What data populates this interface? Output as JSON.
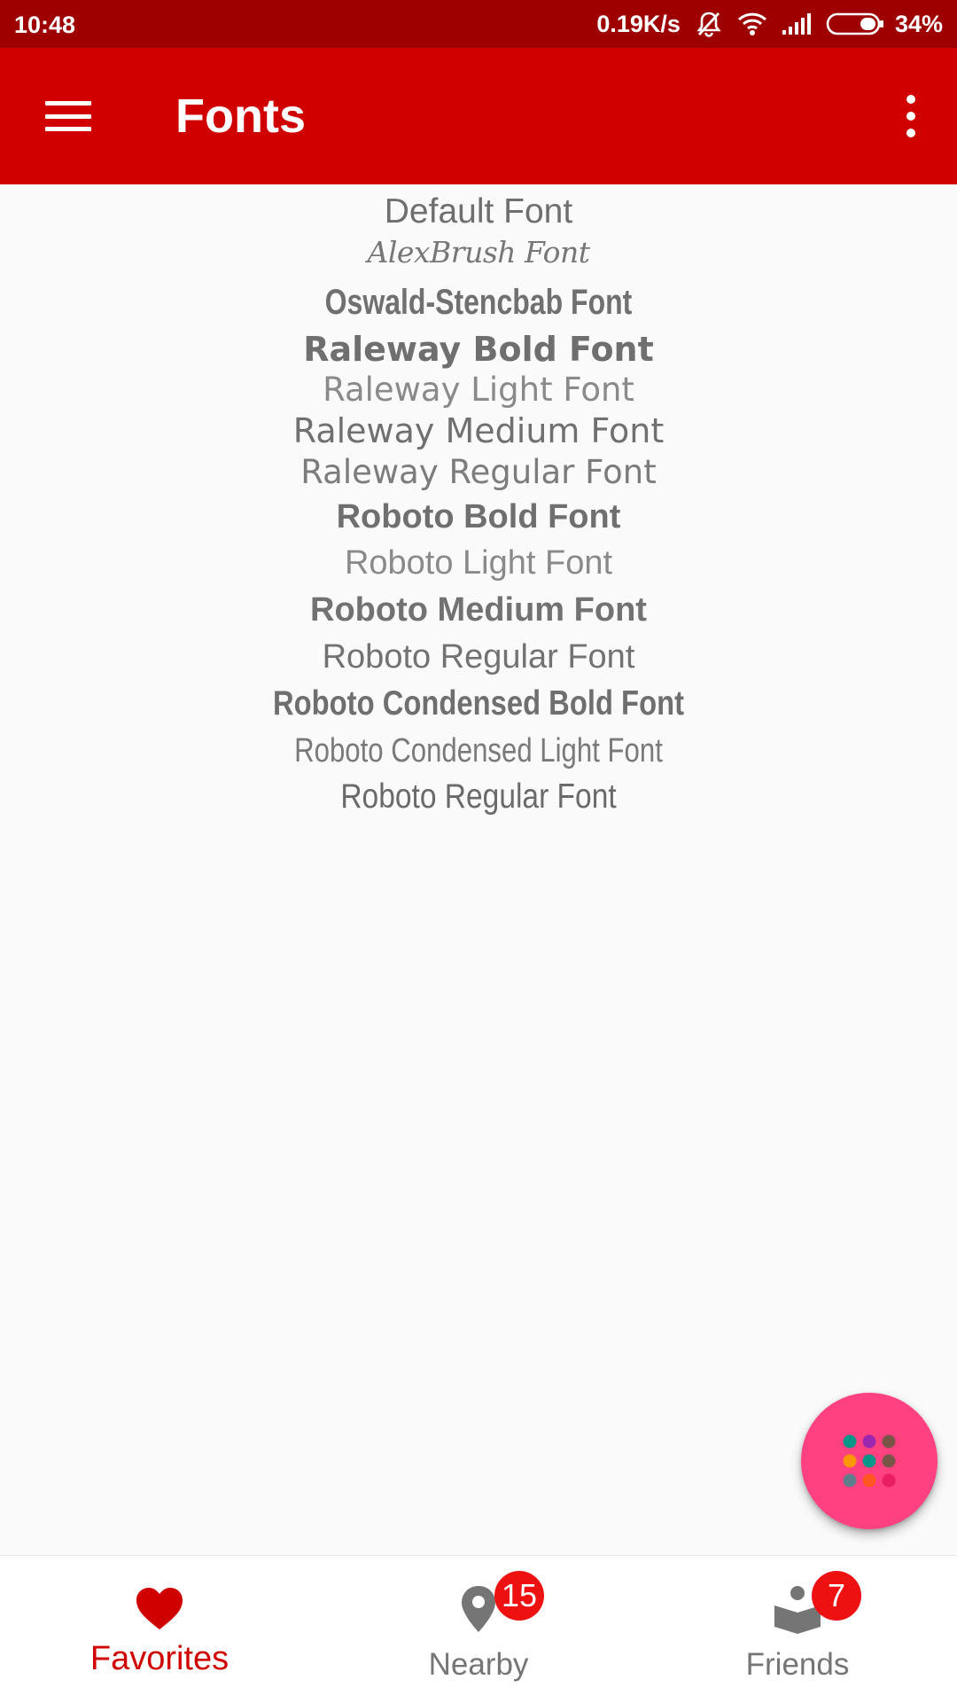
{
  "status_bar": {
    "time": "10:48",
    "network_speed": "0.19K/s",
    "battery_percent": "34%",
    "battery_level": 0.34,
    "icons": [
      "muted-bell-icon",
      "wifi-icon",
      "signal-icon",
      "battery-icon"
    ]
  },
  "app_bar": {
    "title": "Fonts",
    "menu_icon": "hamburger-menu-icon",
    "overflow_icon": "more-vert-icon",
    "background_color": "#d00000",
    "status_bar_color": "#9e0000"
  },
  "fonts": [
    {
      "label": "Default Font"
    },
    {
      "label": "AlexBrush Font"
    },
    {
      "label": "Oswald-Stencbab Font"
    },
    {
      "label": "Raleway Bold Font"
    },
    {
      "label": "Raleway Light Font"
    },
    {
      "label": "Raleway Medium Font"
    },
    {
      "label": "Raleway Regular Font"
    },
    {
      "label": "Roboto Bold Font"
    },
    {
      "label": "Roboto Light Font"
    },
    {
      "label": "Roboto Medium Font"
    },
    {
      "label": "Roboto Regular Font"
    },
    {
      "label": "Roboto Condensed Bold Font"
    },
    {
      "label": "Roboto Condensed Light Font"
    },
    {
      "label": "Roboto Regular Font"
    }
  ],
  "fab": {
    "icon": "dot-grid-icon",
    "color": "#ff4081",
    "dot_colors": [
      "#009688",
      "#9c27b0",
      "#795548",
      "#ff9800",
      "#009688",
      "#795548",
      "#607d8b",
      "#ff5722",
      "#e91e63"
    ]
  },
  "bottom_nav": {
    "items": [
      {
        "label": "Favorites",
        "icon": "heart-icon",
        "active": true
      },
      {
        "label": "Nearby",
        "icon": "location-pin-icon",
        "badge": "15"
      },
      {
        "label": "Friends",
        "icon": "reading-person-icon",
        "badge": "7"
      }
    ],
    "active_color": "#d00000",
    "inactive_color": "#757575",
    "badge_color": "#ee1111"
  }
}
